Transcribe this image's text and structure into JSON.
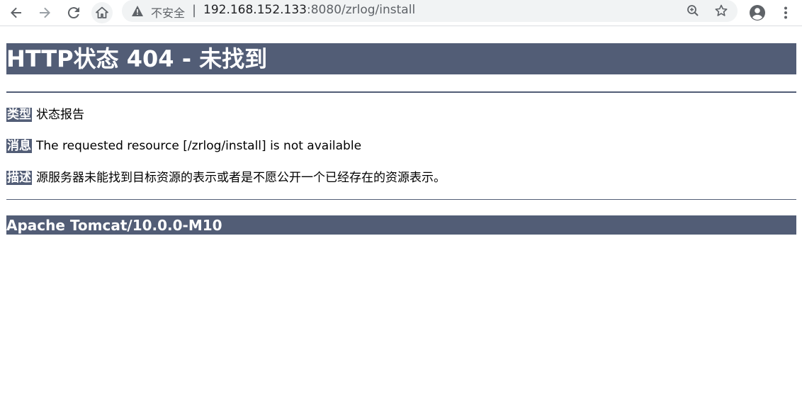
{
  "browser": {
    "security_label": "不安全",
    "separator": "|",
    "url_host": "192.168.152.133",
    "url_rest": ":8080/zrlog/install",
    "icons": [
      "back-icon",
      "forward-icon",
      "reload-icon",
      "home-icon",
      "warning-icon",
      "zoom-icon",
      "star-icon",
      "profile-icon",
      "menu-icon"
    ]
  },
  "page": {
    "title": "HTTP状态 404 - 未找到",
    "type_label": "类型",
    "type_value": "状态报告",
    "message_label": "消息",
    "message_value": "The requested resource [/zrlog/install] is not available",
    "description_label": "描述",
    "description_value": "源服务器未能找到目标资源的表示或者是不愿公开一个已经存在的资源表示。",
    "footer": "Apache Tomcat/10.0.0-M10"
  },
  "colors": {
    "banner": "#525d76",
    "banner_text": "#ffffff",
    "toolbar_icon": "#5f6368",
    "omnibox_bg": "#f1f3f4"
  }
}
